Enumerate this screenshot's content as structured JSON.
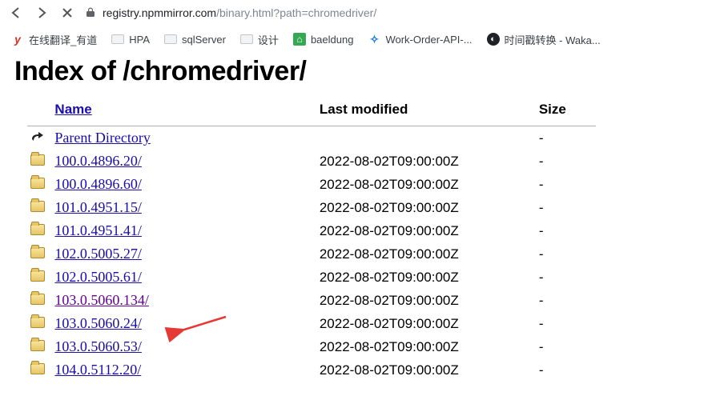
{
  "browser": {
    "url_host": "registry.npmmirror.com",
    "url_path": "/binary.html?path=chromedriver/"
  },
  "bookmarks": [
    {
      "label": "在线翻译_有道",
      "icon": "red-y"
    },
    {
      "label": "HPA",
      "icon": "folder"
    },
    {
      "label": "sqlServer",
      "icon": "folder"
    },
    {
      "label": "设计",
      "icon": "folder"
    },
    {
      "label": "baeldung",
      "icon": "green"
    },
    {
      "label": "Work-Order-API-...",
      "icon": "blue"
    },
    {
      "label": "时间戳转换 - Waka...",
      "icon": "dark"
    }
  ],
  "page": {
    "heading": "Index of /chromedriver/",
    "columns": {
      "name": "Name",
      "modified": "Last modified",
      "size": "Size"
    },
    "parent_label": "Parent Directory",
    "rows": [
      {
        "name": "100.0.4896.20/",
        "modified": "2022-08-02T09:00:00Z",
        "size": "-",
        "visited": false
      },
      {
        "name": "100.0.4896.60/",
        "modified": "2022-08-02T09:00:00Z",
        "size": "-",
        "visited": false
      },
      {
        "name": "101.0.4951.15/",
        "modified": "2022-08-02T09:00:00Z",
        "size": "-",
        "visited": false
      },
      {
        "name": "101.0.4951.41/",
        "modified": "2022-08-02T09:00:00Z",
        "size": "-",
        "visited": false
      },
      {
        "name": "102.0.5005.27/",
        "modified": "2022-08-02T09:00:00Z",
        "size": "-",
        "visited": false
      },
      {
        "name": "102.0.5005.61/",
        "modified": "2022-08-02T09:00:00Z",
        "size": "-",
        "visited": false
      },
      {
        "name": "103.0.5060.134/",
        "modified": "2022-08-02T09:00:00Z",
        "size": "-",
        "visited": true
      },
      {
        "name": "103.0.5060.24/",
        "modified": "2022-08-02T09:00:00Z",
        "size": "-",
        "visited": false
      },
      {
        "name": "103.0.5060.53/",
        "modified": "2022-08-02T09:00:00Z",
        "size": "-",
        "visited": false
      },
      {
        "name": "104.0.5112.20/",
        "modified": "2022-08-02T09:00:00Z",
        "size": "-",
        "visited": false
      }
    ]
  }
}
